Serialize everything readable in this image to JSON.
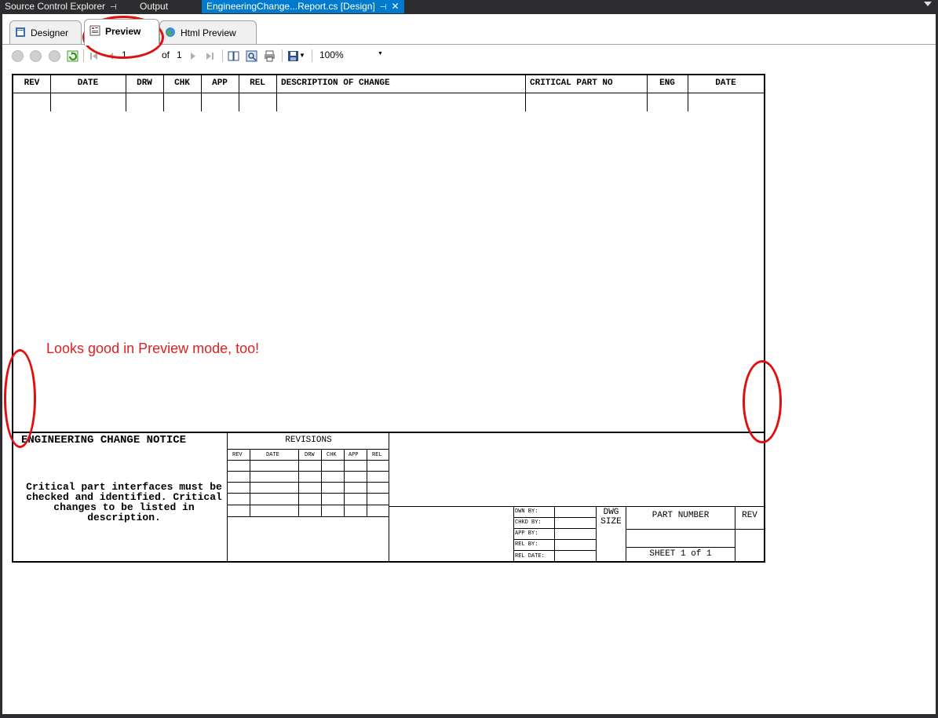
{
  "doc_tabs": {
    "source_control": "Source Control Explorer",
    "output": "Output",
    "active": "EngineeringChange...Report.cs [Design]"
  },
  "view_tabs": {
    "designer": "Designer",
    "preview": "Preview",
    "html_preview": "Html Preview"
  },
  "toolbar": {
    "page": "1",
    "of_label": "of",
    "total": "1",
    "zoom": "100%"
  },
  "table_header": [
    "REV",
    "DATE",
    "DRW",
    "CHK",
    "APP",
    "REL",
    "DESCRIPTION OF CHANGE",
    "CRITICAL PART NO",
    "ENG",
    "DATE"
  ],
  "title_block": {
    "title": "ENGINEERING CHANGE NOTICE",
    "notice": "Critical part interfaces must be checked and identified. Critical changes to be listed in description.",
    "revisions_title": "REVISIONS",
    "revisions_cols": [
      "REV",
      "DATE",
      "DRW",
      "CHK",
      "APP",
      "REL"
    ],
    "sign_labels": [
      "DWN BY:",
      "CHKD BY:",
      "APP BY:",
      "REL BY:",
      "REL DATE:"
    ],
    "dwg_size": "DWG SIZE",
    "part_number": "PART NUMBER",
    "rev": "REV",
    "sheet": "SHEET 1 of 1"
  },
  "annotation": "Looks good in Preview mode, too!",
  "colors": {
    "annotation": "#e02020",
    "tab_active": "#007acc",
    "ide_dark": "#2d2d30"
  }
}
